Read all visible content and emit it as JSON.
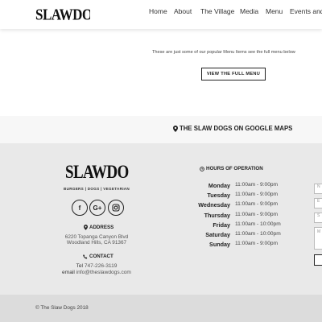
{
  "header": {
    "logo_text": "SLAWDOGS",
    "nav": [
      "Home",
      "About",
      "The Village",
      "Media",
      "Menu",
      "Events and"
    ]
  },
  "content": {
    "popular_text": "These are just some of our popular Menu Items see the full menu below",
    "view_menu_label": "VIEW THE FULL MENU"
  },
  "maps": {
    "label": "THE SLAW DOGS ON GOOGLE MAPS",
    "icon": "map-marker-icon"
  },
  "footer": {
    "logo_text": "SLAWDOGS",
    "tagline": "BURGERS | DOGS | VEGETARIAN",
    "social": [
      {
        "name": "facebook-icon",
        "glyph": "f"
      },
      {
        "name": "google-plus-icon",
        "glyph": "G+"
      },
      {
        "name": "instagram-icon",
        "glyph": ""
      }
    ],
    "address_heading": "ADDRESS",
    "address_line1": "6220 Topanga Canyon Blvd",
    "address_line2": "Woodland Hills, CA 91367",
    "contact_heading": "CONTACT",
    "tel_label": "Tel",
    "tel_value": "747-226-3119",
    "email_label": "email",
    "email_value": "info@theslawdogs.com",
    "hours_heading": "HOURS OF OPERATION",
    "hours": [
      {
        "day": "Monday",
        "time": "11:00am - 9:00pm"
      },
      {
        "day": "Tuesday",
        "time": "11:00am - 9:00pm"
      },
      {
        "day": "Wednesday",
        "time": "11:00am - 9:00pm"
      },
      {
        "day": "Thursday",
        "time": "11:00am - 9:00pm"
      },
      {
        "day": "Friday",
        "time": "11:00am - 10:00pm"
      },
      {
        "day": "Saturday",
        "time": "11:00am - 10:00pm"
      },
      {
        "day": "Sunday",
        "time": "11:00am - 9:00pm"
      }
    ],
    "form_placeholders": [
      "N",
      "E",
      "S",
      "M"
    ],
    "copyright": "© The Slaw Dogs 2018"
  },
  "colors": {
    "text_dark": "#222222",
    "footer_bg": "#e9e9e9",
    "maps_bg": "#f7f7f7",
    "copyright_bg": "#dcdcdc"
  }
}
